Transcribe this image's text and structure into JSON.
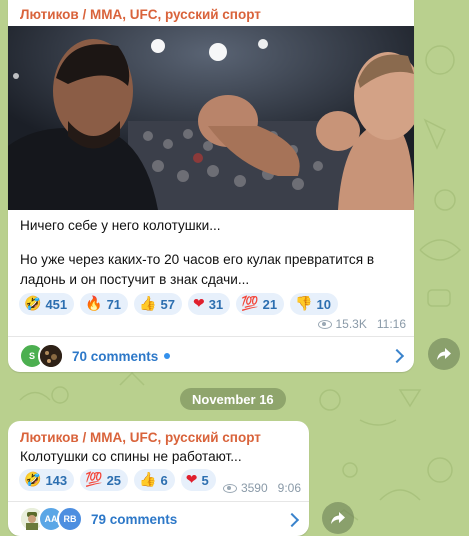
{
  "post1": {
    "channel": "Лютиков / MMA, UFC, русский спорт",
    "text_line1": "Ничего себе у него колотушки...",
    "text_line2": "Но уже через каких-то 20 часов его кулак превратится в",
    "text_line3": "ладонь и он постучит в знак сдачи...",
    "reactions": [
      {
        "emoji": "🤣",
        "count": "451"
      },
      {
        "emoji": "🔥",
        "count": "71"
      },
      {
        "emoji": "👍",
        "count": "57"
      },
      {
        "emoji": "❤",
        "count": "31"
      },
      {
        "emoji": "💯",
        "count": "21"
      },
      {
        "emoji": "👎",
        "count": "10"
      }
    ],
    "views": "15.3K",
    "time": "11:16",
    "avatars": [
      "S",
      ""
    ],
    "comments": "70 comments"
  },
  "date_separator": "November 16",
  "post2": {
    "channel": "Лютиков / MMA, UFC, русский спорт",
    "text": "Колотушки со спины не работают...",
    "reactions": [
      {
        "emoji": "🤣",
        "count": "143"
      },
      {
        "emoji": "💯",
        "count": "25"
      },
      {
        "emoji": "👍",
        "count": "6"
      },
      {
        "emoji": "❤",
        "count": "5"
      }
    ],
    "views": "3590",
    "time": "9:06",
    "avatars": [
      "",
      "AA",
      "RB"
    ],
    "comments": "79 comments"
  },
  "colors": {
    "background": "#b9d08e",
    "channel_name": "#d9633b",
    "accent": "#2d78c8",
    "reaction_bg": "#e7f0fb"
  },
  "icons": [
    "eye-icon",
    "chevron-right-icon",
    "share-icon",
    "unread-dot-icon"
  ]
}
